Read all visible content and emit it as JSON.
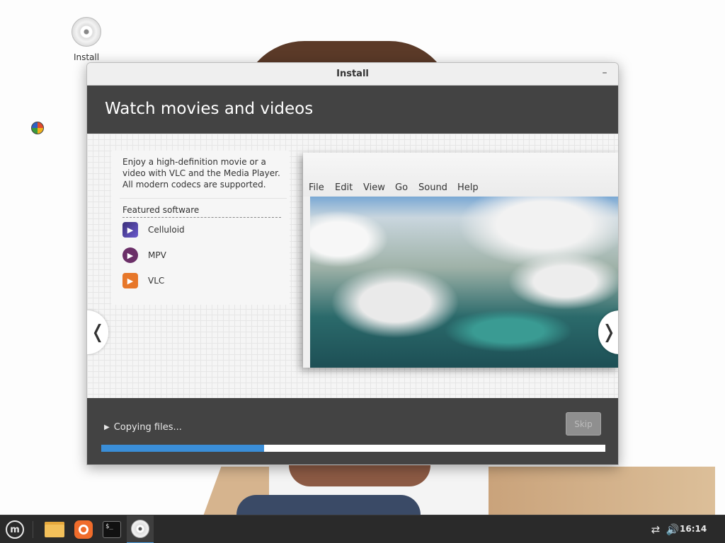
{
  "desktop": {
    "icons": [
      {
        "label": "Install",
        "icon": "cd-disc-icon"
      }
    ]
  },
  "window": {
    "title": "Install",
    "minimize_label": "–",
    "slide": {
      "heading": "Watch movies and videos",
      "description": "Enjoy a high-definition movie or a video with VLC and the Media Player. All modern codecs are supported.",
      "featured_title": "Featured software",
      "apps": [
        {
          "name": "Celluloid",
          "icon": "celluloid-icon"
        },
        {
          "name": "MPV",
          "icon": "mpv-icon"
        },
        {
          "name": "VLC",
          "icon": "vlc-icon"
        }
      ],
      "player_menu": [
        "File",
        "Edit",
        "View",
        "Go",
        "Sound",
        "Help"
      ],
      "prev_arrow": "❬",
      "next_arrow": "❭"
    },
    "footer": {
      "status": "Copying files...",
      "skip_label": "Skip",
      "progress_fraction": 0.323
    }
  },
  "taskbar": {
    "apps": [
      "files-icon",
      "firefox-icon",
      "terminal-icon",
      "installer-disc-icon"
    ],
    "active_app": "installer-disc-icon",
    "terminal_glyph": "$_",
    "clock": "16:14",
    "accent_color": "#3a8ed8"
  }
}
